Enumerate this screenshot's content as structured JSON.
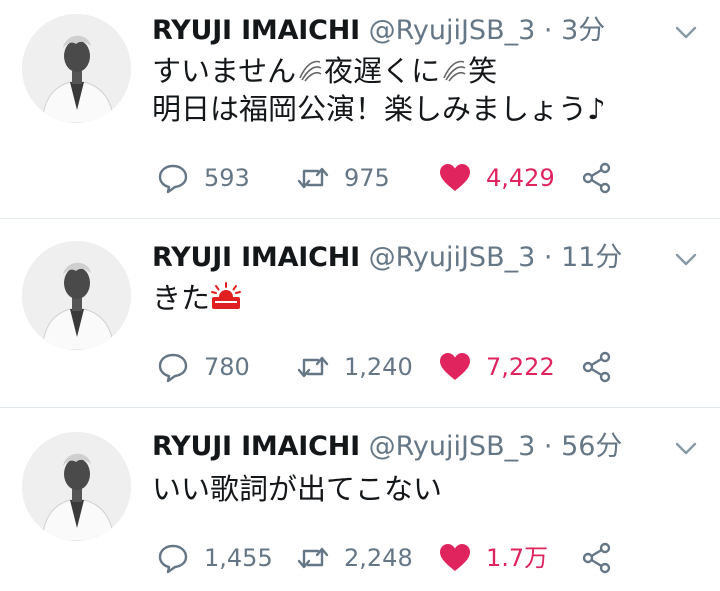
{
  "colors": {
    "text": "#14171a",
    "muted": "#657786",
    "like": "#e0245e",
    "divider": "#e1e8ed"
  },
  "tweets": [
    {
      "name": "RYUJI IMAICHI",
      "handle": "@RyujiJSB_3",
      "separator": "·",
      "time": "3分",
      "text_line1_a": "すいません",
      "text_line1_b": "夜遅くに",
      "text_line1_c": "笑",
      "text_line2": "明日は福岡公演！楽しみましょう♪",
      "replies": "593",
      "retweets": "975",
      "likes": "4,429",
      "liked": true
    },
    {
      "name": "RYUJI IMAICHI",
      "handle": "@RyujiJSB_3",
      "separator": "·",
      "time": "11分",
      "text_line1_a": "きた",
      "replies": "780",
      "retweets": "1,240",
      "likes": "7,222",
      "liked": true
    },
    {
      "name": "RYUJI IMAICHI",
      "handle": "@RyujiJSB_3",
      "separator": "·",
      "time": "56分",
      "text_line1_a": "いい歌詞が出てこない",
      "replies": "1,455",
      "retweets": "2,248",
      "likes": "1.7万",
      "liked": true
    }
  ],
  "icons": {
    "reply": "speech-bubble-icon",
    "retweet": "retweet-icon",
    "like": "heart-icon",
    "share": "share-icon",
    "caret": "chevron-down-icon",
    "emoji_sweat": "sweat-drop-emoji",
    "emoji_sunrise": "sunrise-emoji"
  }
}
